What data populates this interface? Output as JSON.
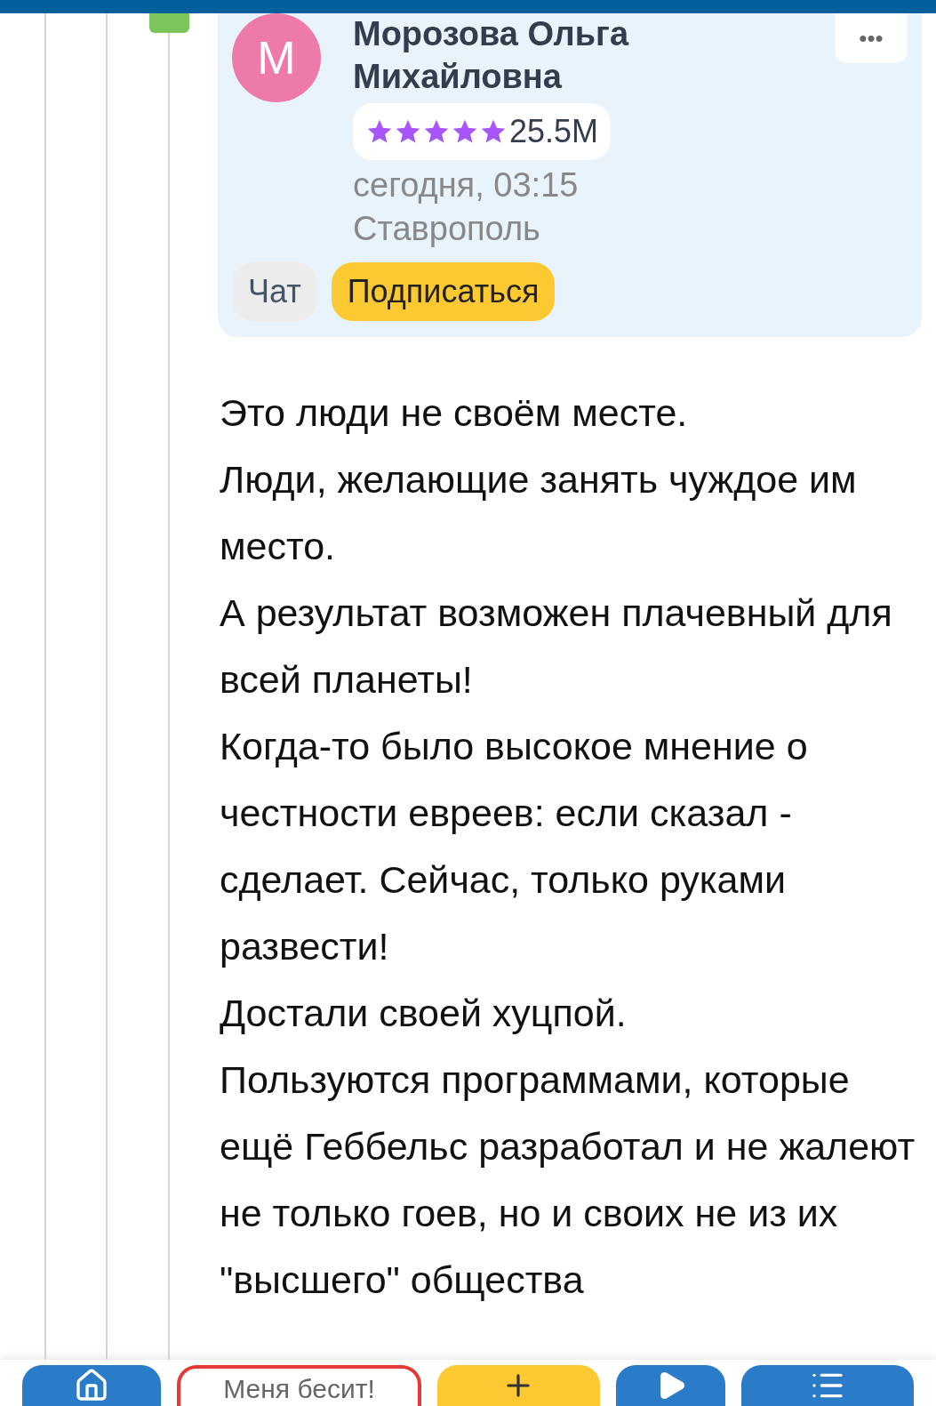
{
  "comment": {
    "author": "Морозова Ольга Михайловна",
    "avatar_letter": "М",
    "stars": 5,
    "rating": "25.5M",
    "date": "сегодня, 03:15",
    "city": "Ставрополь",
    "more": "•••",
    "buttons": [
      {
        "label": "Чат",
        "kind": "chat"
      },
      {
        "label": "Подписаться",
        "kind": "subscribe"
      }
    ],
    "paragraphs": [
      "Это люди не своём месте.",
      "Люди, желающие занять чуждое им место.",
      "А результат возможен плачевный для всей планеты!",
      "Когда-то было высокое мнение о честности евреев: если сказал - сделает. Сейчас, только руками развести!",
      "Достали своей хуцпой.",
      "Пользуются программами, которые ещё Геббельс разработал и не жалеют не только гоев, но и своих не из их \"высшего\" общества"
    ]
  },
  "bottom_bar": [
    {
      "kind": "home"
    },
    {
      "kind": "label",
      "label": "Меня бесит!"
    },
    {
      "kind": "add"
    },
    {
      "kind": "play"
    },
    {
      "kind": "list"
    }
  ]
}
